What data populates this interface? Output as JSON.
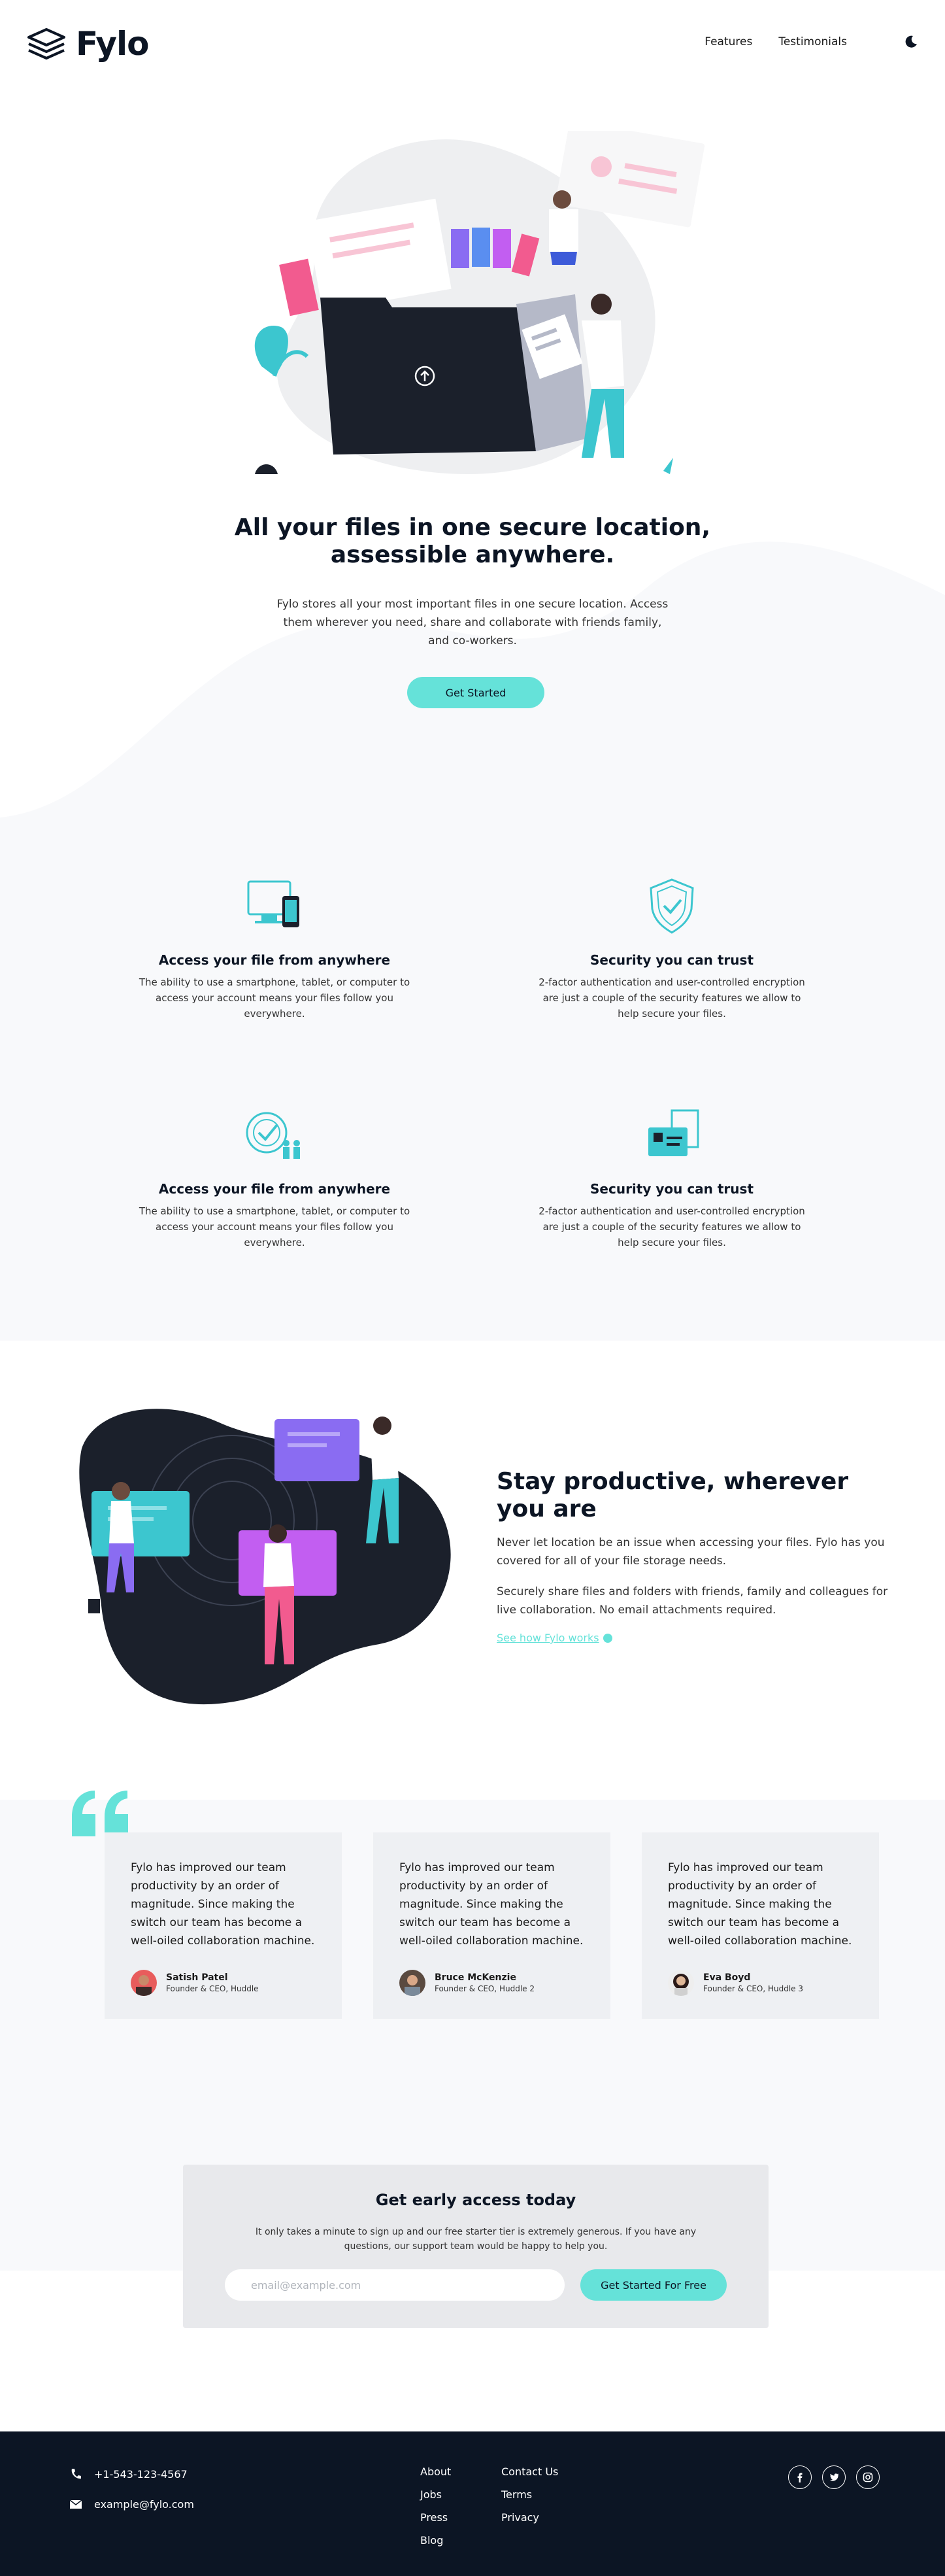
{
  "nav": {
    "brand": "Fylo",
    "links": [
      {
        "label": "Features"
      },
      {
        "label": "Testimonials"
      }
    ]
  },
  "hero": {
    "title": "All your files in one secure location, assessible anywhere.",
    "text": "Fylo stores all your most important files in one secure location. Access them wherever you need, share and collaborate with friends family, and co-workers.",
    "cta": "Get Started"
  },
  "features": [
    {
      "icon": "access-anywhere-icon",
      "title": "Access your file from anywhere",
      "text": "The ability to use a smartphone, tablet, or computer to access your account means your files follow you everywhere."
    },
    {
      "icon": "security-shield-icon",
      "title": "Security you can trust",
      "text": "2-factor authentication and user-controlled encryption are just a couple of the security features we allow to help secure your files."
    },
    {
      "icon": "collaboration-icon",
      "title": "Access your file from anywhere",
      "text": "The ability to use a smartphone, tablet, or computer to access your account means your files follow you everywhere."
    },
    {
      "icon": "any-file-icon",
      "title": "Security you can trust",
      "text": "2-factor authentication and user-controlled encryption are just a couple of the security features we allow to help secure your files."
    }
  ],
  "productive": {
    "title": "Stay productive, wherever you are",
    "p1": "Never let location be an issue when accessing your files. Fylo has you covered for all of your file storage needs.",
    "p2": "Securely share files and folders with friends, family and colleagues for live collaboration. No email attachments required.",
    "link": "See how Fylo works"
  },
  "testimonials": [
    {
      "quote": "Fylo has improved our team productivity by an order of magnitude. Since making the switch our team has become a well-oiled collaboration machine.",
      "name": "Satish Patel",
      "role": "Founder & CEO, Huddle"
    },
    {
      "quote": "Fylo has improved our team productivity by an order of magnitude. Since making the switch our team has become a well-oiled collaboration machine.",
      "name": "Bruce McKenzie",
      "role": "Founder & CEO, Huddle 2"
    },
    {
      "quote": "Fylo has improved our team productivity by an order of magnitude. Since making the switch our team has become a well-oiled collaboration machine.",
      "name": "Eva Boyd",
      "role": "Founder & CEO, Huddle 3"
    }
  ],
  "early": {
    "title": "Get early access today",
    "text": "It only takes a minute to sign up and our free starter tier is extremely generous. If you have any questions, our support team would be happy to help you.",
    "placeholder": "email@example.com",
    "button": "Get Started For Free"
  },
  "footer": {
    "phone": "+1-543-123-4567",
    "email": "example@fylo.com",
    "col1": [
      "About",
      "Jobs",
      "Press",
      "Blog"
    ],
    "col2": [
      "Contact Us",
      "Terms",
      "Privacy"
    ],
    "social": [
      "facebook-icon",
      "twitter-icon",
      "instagram-icon"
    ]
  },
  "colors": {
    "accent": "#65e2d9",
    "dark": "#0c1524",
    "light_bg": "#f8f9fb"
  }
}
